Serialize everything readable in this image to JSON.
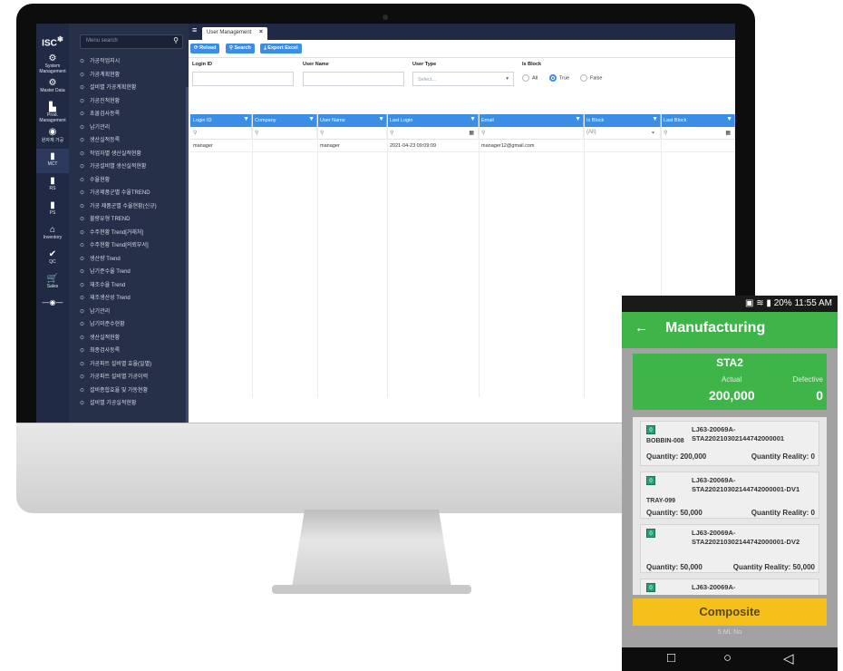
{
  "desktop": {
    "iconbar": [
      {
        "icon": "gears-icon",
        "label": "System Management"
      },
      {
        "icon": "gears-icon",
        "label": "Master Data"
      },
      {
        "icon": "chart-icon",
        "label": "Prod. Management"
      },
      {
        "icon": "gauge-icon",
        "label": "원자재 가공"
      },
      {
        "icon": "cylinder-icon",
        "label": "MCT"
      },
      {
        "icon": "cylinder-icon",
        "label": "RS"
      },
      {
        "icon": "cylinder-icon",
        "label": "PS"
      },
      {
        "icon": "warehouse-icon",
        "label": "Inventory"
      },
      {
        "icon": "user-check-icon",
        "label": "QC"
      },
      {
        "icon": "cart-icon",
        "label": "Sales"
      }
    ],
    "menu_search_placeholder": "Menu search",
    "menu_items": [
      "가공작업지시",
      "가공계획현황",
      "설비별 가공계획현황",
      "가공진척현황",
      "초물검사등록",
      "납기관리",
      "생산실적등록",
      "작업자별 생산실적현황",
      "가공설비별 생산실적현황",
      "수율현황",
      "가공제품군별 수율TREND",
      "가공 제품군별 수율현황(신규)",
      "불량유형 TREND",
      "수주현황 Trend[거래처]",
      "수주현황 Trend[의뢰부서]",
      "생산량 Trend",
      "납기준수율 Trend",
      "재조수율 Trend",
      "재조생산성 Trend",
      "납기관리",
      "납기미준수현황",
      "생산실적현황",
      "최종검사등록",
      "가공파트 설비별 효율(일별)",
      "가공파트 설비별 가공이력",
      "설비종합효율 및 가동현황",
      "설비별 가공실적현황"
    ],
    "tab_label": "User Management",
    "toolbar": {
      "reload": "Reload",
      "search": "Search",
      "export": "Export Excel"
    },
    "filters": {
      "login_id_label": "Login ID",
      "user_name_label": "User Name",
      "user_type_label": "User Type",
      "user_type_placeholder": "Select...",
      "is_block_label": "Is Block",
      "radio_all": "All",
      "radio_true": "True",
      "radio_false": "False"
    },
    "grid": {
      "columns": [
        "Login ID",
        "Company",
        "User Name",
        "Last Login",
        "Email",
        "Is Block",
        "Last Block"
      ],
      "is_block_filter": "(All)",
      "rows": [
        {
          "login_id": "manager",
          "company": "",
          "user_name": "manager",
          "last_login": "2021-04-23 09:09:09",
          "email": "manager12@gmail.com",
          "is_block": "",
          "last_block": ""
        }
      ]
    }
  },
  "phone": {
    "status": "20% 11:55 AM",
    "title": "Manufacturing",
    "station": "STA2",
    "actual_label": "Actual",
    "defective_label": "Defective",
    "actual_value": "200,000",
    "defective_value": "0",
    "items": [
      {
        "badge": "0",
        "code": "BOBBIN-008",
        "lot": "LJ63-20069A-STA220210302144742000001",
        "qty": "Quantity: 200,000",
        "qr": "Quantity Reality: 0"
      },
      {
        "badge": "0",
        "code": "TRAY-099",
        "lot": "LJ63-20069A-STA220210302144742000001-DV1",
        "qty": "Quantity: 50,000",
        "qr": "Quantity Reality: 0"
      },
      {
        "badge": "0",
        "code": "",
        "lot": "LJ63-20069A-STA220210302144742000001-DV2",
        "qty": "Quantity: 50,000",
        "qr": "Quantity Reality: 50,000"
      },
      {
        "badge": "0",
        "code": "",
        "lot": "LJ63-20069A-",
        "qty": "",
        "qr": ""
      }
    ],
    "composite_label": "Composite",
    "footer": "5 ML No"
  }
}
